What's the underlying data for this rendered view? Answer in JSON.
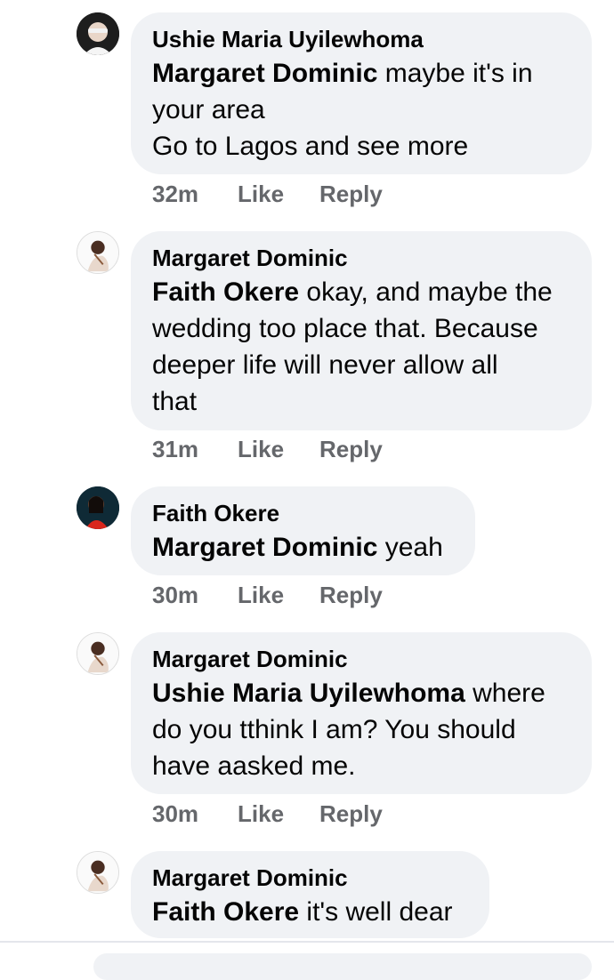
{
  "comments": [
    {
      "author": "Ushie Maria Uyilewhoma",
      "mention": "Margaret Dominic",
      "text_lines": [
        " maybe it's in",
        "your area",
        "Go to Lagos and see more"
      ],
      "time": "32m",
      "like": "Like",
      "reply": "Reply"
    },
    {
      "author": "Margaret Dominic",
      "mention": "Faith Okere",
      "text_lines": [
        " okay, and maybe the",
        "wedding too place that. Because",
        "deeper life will never allow all",
        "that"
      ],
      "time": "31m",
      "like": "Like",
      "reply": "Reply"
    },
    {
      "author": "Faith Okere",
      "mention": "Margaret Dominic",
      "text_lines": [
        " yeah"
      ],
      "time": "30m",
      "like": "Like",
      "reply": "Reply"
    },
    {
      "author": "Margaret Dominic",
      "mention": "Ushie Maria Uyilewhoma",
      "text_lines": [
        " where",
        "do you tthink I am? You should",
        "have aasked me."
      ],
      "time": "30m",
      "like": "Like",
      "reply": "Reply"
    },
    {
      "author": "Margaret Dominic",
      "mention": "Faith Okere",
      "text_lines": [
        " it's well dear"
      ]
    }
  ],
  "colors": {
    "bubble": "#f0f2f5",
    "meta": "#65676b",
    "text": "#050505"
  }
}
